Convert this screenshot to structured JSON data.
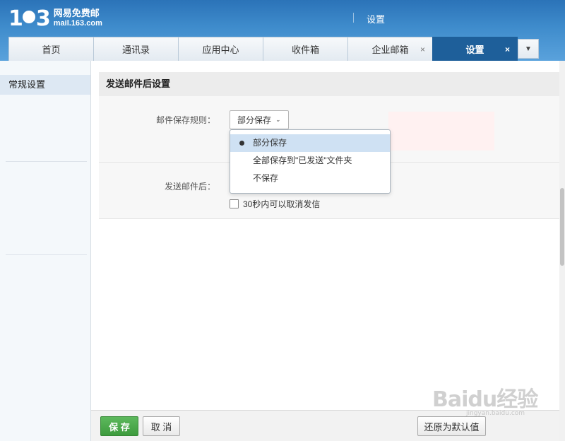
{
  "logo": {
    "number": "163",
    "brand": "网易免费邮",
    "domain": "mail.163.com"
  },
  "header": {
    "title": "设置"
  },
  "tabs": [
    {
      "label": "首页"
    },
    {
      "label": "通讯录"
    },
    {
      "label": "应用中心"
    },
    {
      "label": "收件箱"
    },
    {
      "label": "企业邮箱",
      "close": "×"
    },
    {
      "label": "设置",
      "close": "×"
    }
  ],
  "sidebar": {
    "items": [
      {
        "label": "常规设置"
      }
    ]
  },
  "section": {
    "title": "发送邮件后设置"
  },
  "save_rule": {
    "label": "邮件保存规则：",
    "selected": "部分保存"
  },
  "dropdown": {
    "options": [
      {
        "label": "部分保存",
        "selected": true
      },
      {
        "label": "全部保存到\"已发送\"文件夹"
      },
      {
        "label": "不保存"
      }
    ]
  },
  "after_send": {
    "label": "发送邮件后：",
    "undo_label": "30秒内可以取消发信",
    "undo_checked": false
  },
  "footer": {
    "save": "保 存",
    "cancel": "取 消",
    "reset": "还原为默认值"
  },
  "watermark": {
    "text": "Baidu经验",
    "url": "jingyan.baidu.com"
  }
}
